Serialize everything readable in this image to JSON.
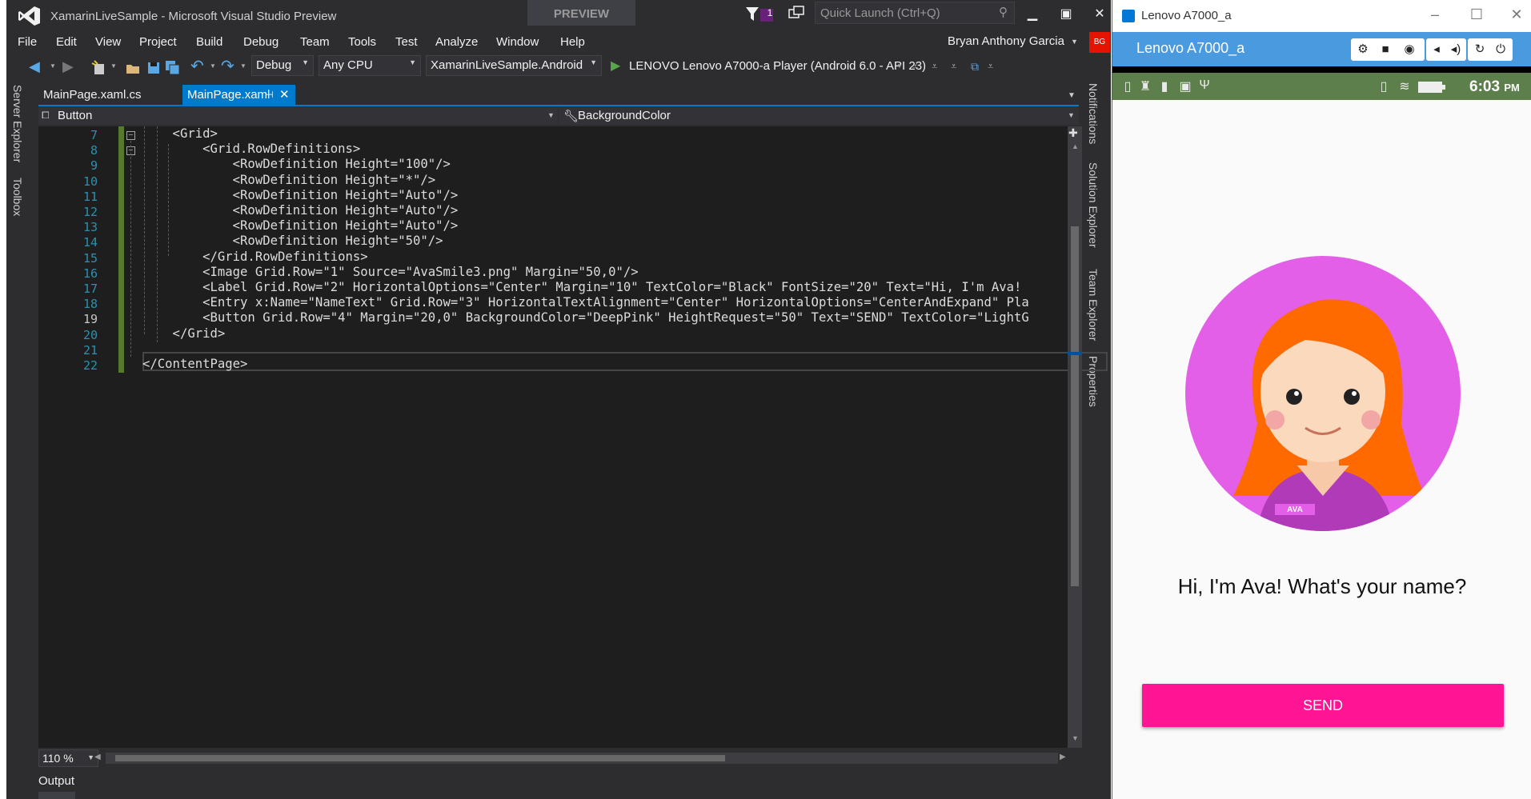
{
  "vs": {
    "title": "XamarinLiveSample - Microsoft Visual Studio Preview",
    "preview_badge": "PREVIEW",
    "notification_count": "1",
    "quick_launch_placeholder": "Quick Launch (Ctrl+Q)",
    "menu": [
      "File",
      "Edit",
      "View",
      "Project",
      "Build",
      "Debug",
      "Team",
      "Tools",
      "Test",
      "Analyze",
      "Window",
      "Help"
    ],
    "user_name": "Bryan Anthony Garcia",
    "user_initials": "BG",
    "toolbar": {
      "config": "Debug",
      "platform": "Any CPU",
      "startup_project": "XamarinLiveSample.Android",
      "run_target": "LENOVO Lenovo A7000-a Player (Android 6.0 - API 23)"
    },
    "left_tabs": [
      "Server Explorer",
      "Toolbox"
    ],
    "right_tabs": [
      "Notifications",
      "Solution Explorer",
      "Team Explorer",
      "Properties"
    ],
    "tabs": [
      {
        "label": "MainPage.xaml.cs",
        "active": false
      },
      {
        "label": "MainPage.xaml",
        "active": true
      }
    ],
    "nav_left": "Button",
    "nav_right": "BackgroundColor",
    "code_lines": [
      {
        "num": "7",
        "text": "    <Grid>"
      },
      {
        "num": "8",
        "text": "        <Grid.RowDefinitions>"
      },
      {
        "num": "9",
        "text": "            <RowDefinition Height=\"100\"/>"
      },
      {
        "num": "10",
        "text": "            <RowDefinition Height=\"*\"/>"
      },
      {
        "num": "11",
        "text": "            <RowDefinition Height=\"Auto\"/>"
      },
      {
        "num": "12",
        "text": "            <RowDefinition Height=\"Auto\"/>"
      },
      {
        "num": "13",
        "text": "            <RowDefinition Height=\"Auto\"/>"
      },
      {
        "num": "14",
        "text": "            <RowDefinition Height=\"50\"/>"
      },
      {
        "num": "15",
        "text": "        </Grid.RowDefinitions>"
      },
      {
        "num": "16",
        "text": "        <Image Grid.Row=\"1\" Source=\"AvaSmile3.png\" Margin=\"50,0\"/>"
      },
      {
        "num": "17",
        "text": "        <Label Grid.Row=\"2\" HorizontalOptions=\"Center\" Margin=\"10\" TextColor=\"Black\" FontSize=\"20\" Text=\"Hi, I'm Ava!"
      },
      {
        "num": "18",
        "text": "        <Entry x:Name=\"NameText\" Grid.Row=\"3\" HorizontalTextAlignment=\"Center\" HorizontalOptions=\"CenterAndExpand\" Pla"
      },
      {
        "num": "19",
        "text": "        <Button Grid.Row=\"4\" Margin=\"20,0\" BackgroundColor=\"DeepPink\" HeightRequest=\"50\" Text=\"SEND\" TextColor=\"LightG"
      },
      {
        "num": "20",
        "text": "    </Grid>"
      },
      {
        "num": "21",
        "text": ""
      },
      {
        "num": "22",
        "text": "</ContentPage>"
      }
    ],
    "current_line": "19",
    "zoom": "110 %",
    "output_label": "Output",
    "colors": {
      "accent": "#007acc",
      "editor_bg": "#1e1e1e",
      "change_bar": "#57792e"
    }
  },
  "player": {
    "window_title": "Lenovo A7000_a",
    "header_title": "Lenovo A7000_a",
    "controls": [
      "gear-icon",
      "camera-icon",
      "screenshot-icon",
      "volume-down-icon",
      "volume-up-icon",
      "rotate-icon",
      "power-icon"
    ],
    "status_time": "6:03",
    "status_ampm": "PM",
    "greeting": "Hi, I'm Ava! What's your name?",
    "send_label": "SEND",
    "badge": "AVA",
    "colors": {
      "header": "#4a9ae0",
      "status_bar": "#5d7f4b",
      "send": "#ff1493",
      "ava_circle": "#e35fe7"
    }
  }
}
